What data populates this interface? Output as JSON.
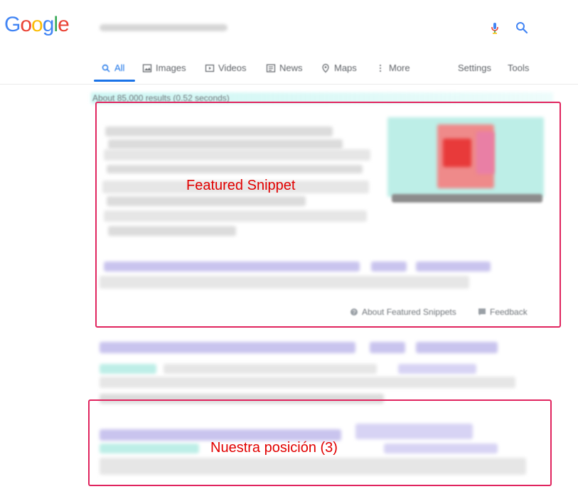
{
  "logo": {
    "letters": [
      "G",
      "o",
      "o",
      "g",
      "l",
      "e"
    ],
    "colors": [
      "#4285f4",
      "#ea4335",
      "#fbbc05",
      "#4285f4",
      "#34a853",
      "#ea4335"
    ]
  },
  "search": {
    "placeholder": "",
    "mic_icon": "microphone-icon",
    "search_icon": "search-icon"
  },
  "tabs": [
    {
      "label": "All",
      "icon": "search-icon",
      "active": true
    },
    {
      "label": "Images",
      "icon": "image-icon"
    },
    {
      "label": "Videos",
      "icon": "video-icon"
    },
    {
      "label": "News",
      "icon": "news-icon"
    },
    {
      "label": "Maps",
      "icon": "map-icon"
    },
    {
      "label": "More",
      "icon": "more-icon"
    }
  ],
  "tools": {
    "settings": "Settings",
    "tools": "Tools"
  },
  "stats": "About 85,000 results (0.52 seconds)",
  "annotations": {
    "featured_snippet": "Featured Snippet",
    "our_position": "Nuestra posición (3)",
    "highlight_color": "#e0245e",
    "label_color": "#e10000"
  },
  "featured_footer": {
    "about": "About Featured Snippets",
    "feedback": "Feedback"
  },
  "accent": "#1a73e8"
}
